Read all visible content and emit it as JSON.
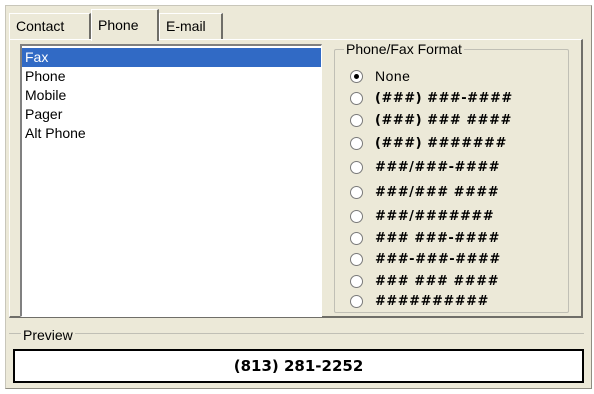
{
  "tabs": [
    {
      "label": "Contact"
    },
    {
      "label": "Phone"
    },
    {
      "label": "E-mail"
    }
  ],
  "phone_types": [
    {
      "label": "Fax"
    },
    {
      "label": "Phone"
    },
    {
      "label": "Mobile"
    },
    {
      "label": "Pager"
    },
    {
      "label": "Alt Phone"
    }
  ],
  "format_group": {
    "title": "Phone/Fax Format",
    "options": [
      {
        "label": "None",
        "checked": true
      },
      {
        "label": "(###) ###-####"
      },
      {
        "label": "(###) ### ####"
      },
      {
        "label": "(###) #######"
      },
      {
        "label": "###/###-####"
      },
      {
        "label": "###/### ####"
      },
      {
        "label": "###/#######"
      },
      {
        "label": "### ###-####"
      },
      {
        "label": "###-###-####"
      },
      {
        "label": "### ### ####"
      },
      {
        "label": "##########"
      }
    ]
  },
  "preview": {
    "title": "Preview",
    "value": "(813) 281-2252"
  }
}
